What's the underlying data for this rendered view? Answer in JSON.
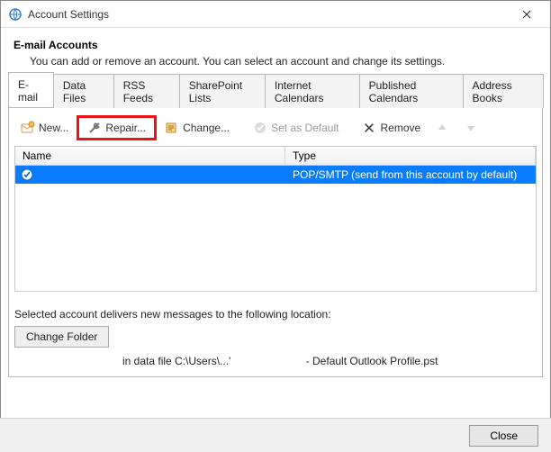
{
  "window": {
    "title": "Account Settings"
  },
  "header": {
    "title": "E-mail Accounts",
    "subtitle": "You can add or remove an account. You can select an account and change its settings."
  },
  "tabs": {
    "email": "E-mail",
    "datafiles": "Data Files",
    "rss": "RSS Feeds",
    "sharepoint": "SharePoint Lists",
    "internetcal": "Internet Calendars",
    "pubcal": "Published Calendars",
    "addrbooks": "Address Books"
  },
  "toolbar": {
    "new": "New...",
    "repair": "Repair...",
    "change": "Change...",
    "setdefault": "Set as Default",
    "remove": "Remove"
  },
  "columns": {
    "name": "Name",
    "type": "Type"
  },
  "accounts": [
    {
      "name": "",
      "type": "POP/SMTP (send from this account by default)"
    }
  ],
  "location": {
    "label": "Selected account delivers new messages to the following location:",
    "change_folder": "Change Folder",
    "path_prefix": "in data file C:\\Users\\...'",
    "path_suffix": "- Default Outlook Profile.pst"
  },
  "footer": {
    "close": "Close"
  }
}
